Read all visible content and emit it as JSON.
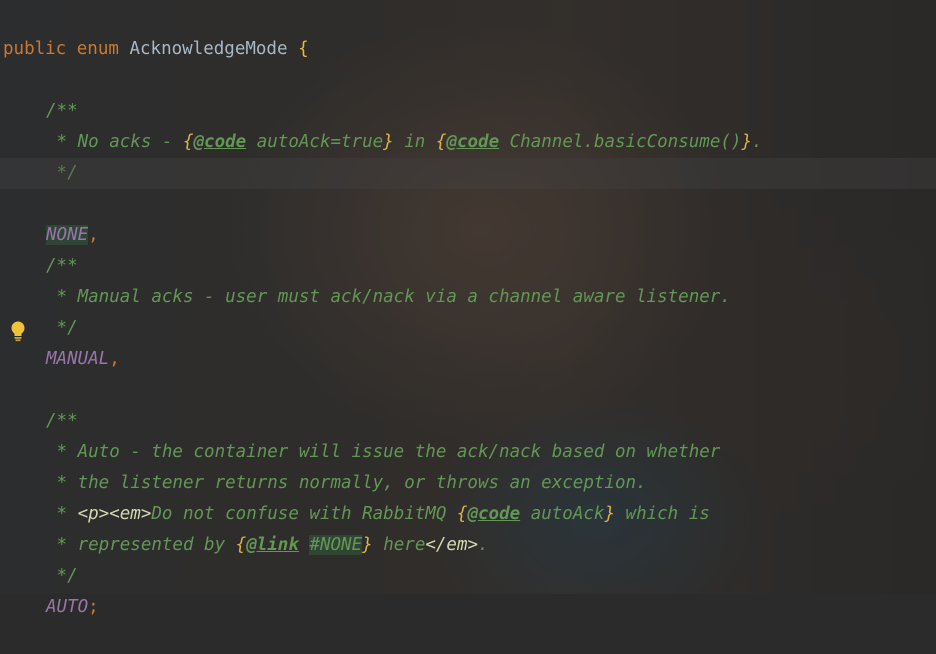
{
  "editor": {
    "declaration": {
      "public_kw": "public",
      "enum_kw": "enum",
      "name": "AcknowledgeMode",
      "open_brace": "{"
    },
    "none_block": {
      "doc_open": "/**",
      "line_prefix": " * No acks - ",
      "brace1_open": "{",
      "tag1": "@code",
      "text1": " autoAck=true",
      "brace1_close": "}",
      "middle": " in ",
      "brace2_open": "{",
      "tag2": "@code",
      "text2": " Channel.basicConsume()",
      "brace2_close": "}",
      "period": ".",
      "doc_close": " */",
      "constant": "NONE",
      "comma": ","
    },
    "manual_block": {
      "doc_open": "/**",
      "line1": " * Manual acks - user must ack/nack via a channel aware listener.",
      "doc_close": " */",
      "constant": "MANUAL",
      "comma": ","
    },
    "auto_block": {
      "doc_open": "/**",
      "line1": " * Auto - the container will issue the ack/nack based on whether",
      "line2": " * the listener returns normally, or throws an exception.",
      "line3_prefix": " * ",
      "line3_tag_p": "<p>",
      "line3_tag_em": "<em>",
      "line3_text": "Do not confuse with RabbitMQ ",
      "line3_brace_open": "{",
      "line3_tag": "@code",
      "line3_code": " autoAck",
      "line3_brace_close": "}",
      "line3_suffix": " which is",
      "line4_prefix": " * represented by ",
      "line4_brace_open": "{",
      "line4_tag": "@link",
      "line4_space": " ",
      "line4_ref": "#NONE",
      "line4_brace_close": "}",
      "line4_text": " here",
      "line4_tag_em_close": "</em>",
      "line4_period": ".",
      "doc_close": " */",
      "constant": "AUTO",
      "semicolon": ";"
    }
  },
  "gutter": {
    "icon": "lightbulb-icon",
    "icon_color": "#f0c23a"
  },
  "colors": {
    "keyword": "#cc7832",
    "doc_comment": "#629755",
    "enum_constant": "#9876aa",
    "text": "#a9b7c6"
  }
}
